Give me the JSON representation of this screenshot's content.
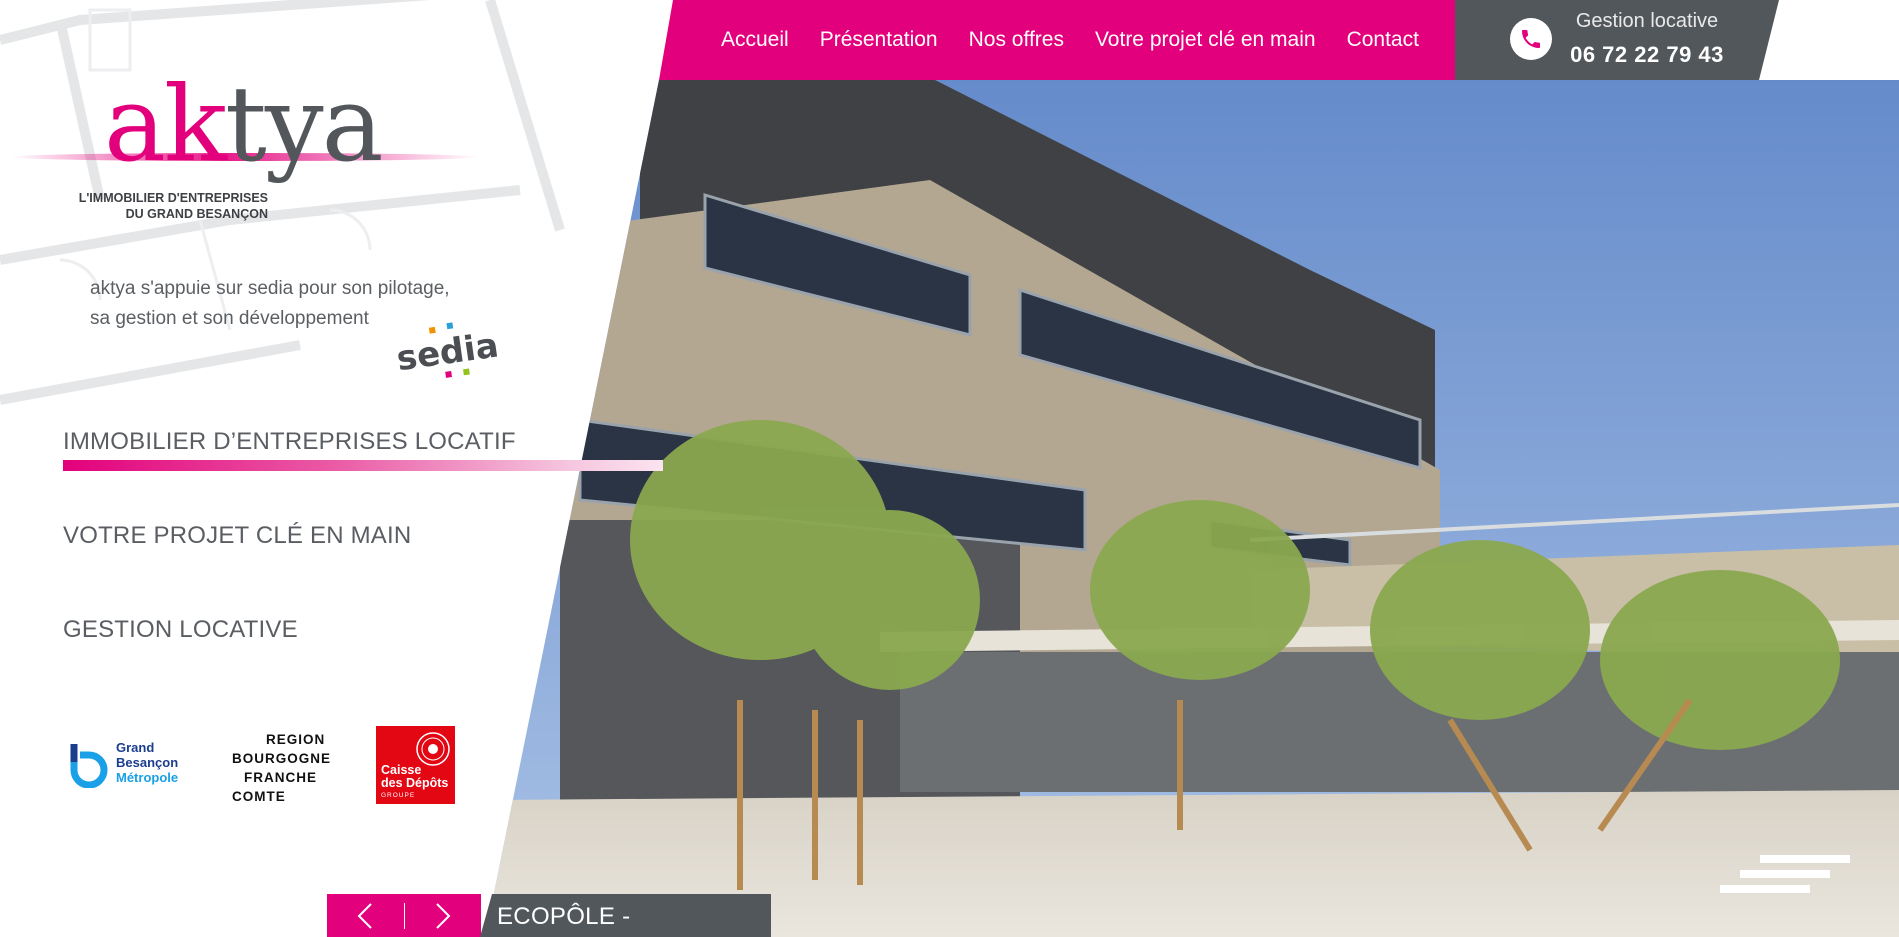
{
  "nav": {
    "items": [
      {
        "label": "Accueil"
      },
      {
        "label": "Présentation"
      },
      {
        "label": "Nos offres"
      },
      {
        "label": "Votre projet clé en main"
      },
      {
        "label": "Contact"
      }
    ]
  },
  "contact": {
    "label": "Gestion locative",
    "phone": "06 72 22 79 43",
    "icon": "phone-icon"
  },
  "logo": {
    "word_pink": "ak",
    "word_grey": "tya",
    "tagline_line1": "L'IMMOBILIER D'ENTREPRISES",
    "tagline_line2": "DU GRAND BESANÇON"
  },
  "intro": {
    "line1": "aktya s'appuie sur sedia pour son pilotage,",
    "line2": "sa gestion et son développement",
    "partner_logo": "sedia"
  },
  "menu": {
    "items": [
      {
        "label": "IMMOBILIER D’ENTREPRISES LOCATIF",
        "active": true
      },
      {
        "label": "VOTRE PROJET CLÉ EN MAIN",
        "active": false
      },
      {
        "label": "GESTION LOCATIVE",
        "active": false
      }
    ]
  },
  "partners": {
    "grand_besancon": {
      "line1": "Grand",
      "line2": "Besançon",
      "line3": "Métropole"
    },
    "region": {
      "line1": "REGION",
      "line2": "BOURGOGNE",
      "line3": "FRANCHE",
      "line4": "COMTE"
    },
    "cdc": {
      "line1": "Caisse",
      "line2": "des Dépôts",
      "line3": "GROUPE"
    }
  },
  "slider": {
    "caption": "ECOPÔLE - BESANÇON",
    "prev_icon": "chevron-left-icon",
    "next_icon": "chevron-right-icon"
  },
  "colors": {
    "brand_pink": "#e3007c",
    "dark_grey": "#52575b",
    "text_grey": "#5a5e63"
  }
}
